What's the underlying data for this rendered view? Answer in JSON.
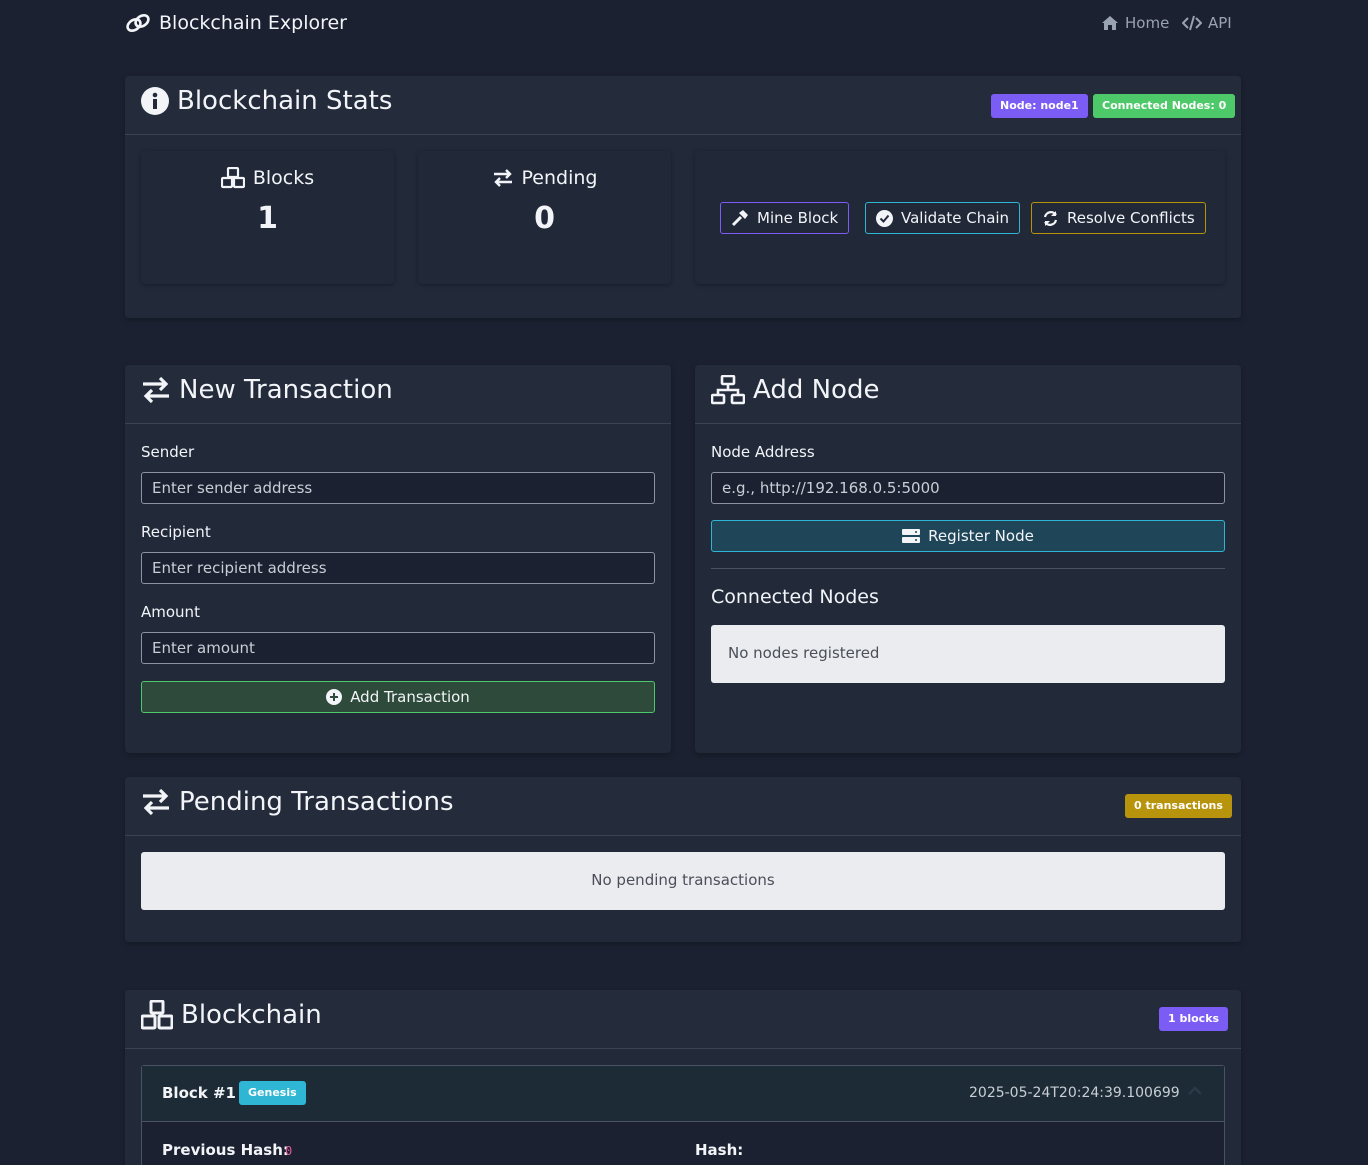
{
  "navbar": {
    "brand": "Blockchain Explorer",
    "links": [
      {
        "label": "Home",
        "icon": "home-icon"
      },
      {
        "label": "API",
        "icon": "code-icon"
      }
    ]
  },
  "stats": {
    "title": "Blockchain Stats",
    "node_badge": "Node: node1",
    "connected_badge": "Connected Nodes: 0",
    "blocks_label": "Blocks",
    "blocks_value": "1",
    "pending_label": "Pending",
    "pending_value": "0",
    "actions": {
      "mine": "Mine Block",
      "validate": "Validate Chain",
      "resolve": "Resolve Conflicts"
    }
  },
  "transaction_form": {
    "title": "New Transaction",
    "sender_label": "Sender",
    "sender_placeholder": "Enter sender address",
    "recipient_label": "Recipient",
    "recipient_placeholder": "Enter recipient address",
    "amount_label": "Amount",
    "amount_placeholder": "Enter amount",
    "submit": "Add Transaction"
  },
  "node_form": {
    "title": "Add Node",
    "address_label": "Node Address",
    "address_placeholder": "e.g., http://192.168.0.5:5000",
    "submit": "Register Node",
    "connected_title": "Connected Nodes",
    "empty_text": "No nodes registered"
  },
  "pending": {
    "title": "Pending Transactions",
    "badge": "0 transactions",
    "empty_text": "No pending transactions"
  },
  "chain": {
    "title": "Blockchain",
    "badge": "1 blocks",
    "blocks": [
      {
        "title": "Block #1",
        "tag": "Genesis",
        "timestamp": "2025-05-24T20:24:39.100699",
        "previous_hash_label": "Previous Hash:",
        "previous_hash": "0",
        "hash_label": "Hash:"
      }
    ]
  },
  "colors": {
    "background": "#1b2130",
    "card": "#222a3a",
    "purple": "#7b5cf5",
    "green": "#4ec96a",
    "teal": "#2fb6d4",
    "gold": "#b8930c",
    "pink": "#e05a9c"
  }
}
